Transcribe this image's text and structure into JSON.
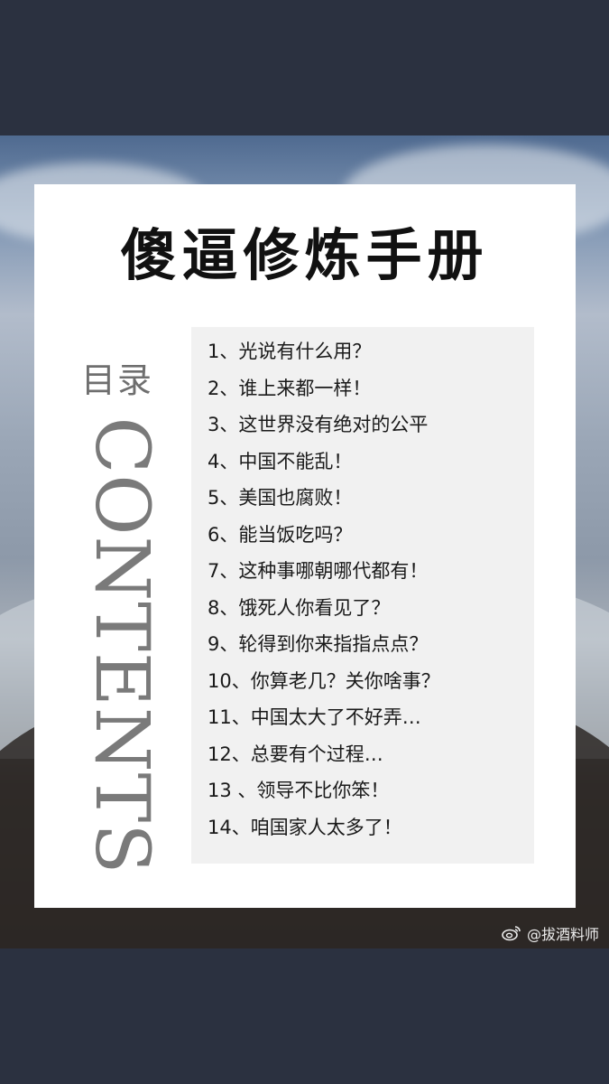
{
  "title": "傻逼修炼手册",
  "side_label_cn": "目录",
  "side_label_en": "CONTENTS",
  "items": [
    "1、光说有什么用？",
    "2、谁上来都一样！",
    "3、这世界没有绝对的公平",
    "4、中国不能乱！",
    "5、美国也腐败！",
    "6、能当饭吃吗？",
    "7、这种事哪朝哪代都有！",
    "8、饿死人你看见了？",
    "9、轮得到你来指指点点？",
    "10、你算老几？关你啥事？",
    "11、中国太大了不好弄…",
    "12、总要有个过程…",
    "13 、领导不比你笨！",
    "14、咱国家人太多了！"
  ],
  "watermark": "@拔酒料师",
  "icons": {
    "watermark": "weibo-logo-icon"
  },
  "colors": {
    "frame": "#2b3140",
    "card": "#ffffff",
    "list_box": "#f1f1f1",
    "title": "#111111",
    "side_label": "#6f6f6f"
  }
}
